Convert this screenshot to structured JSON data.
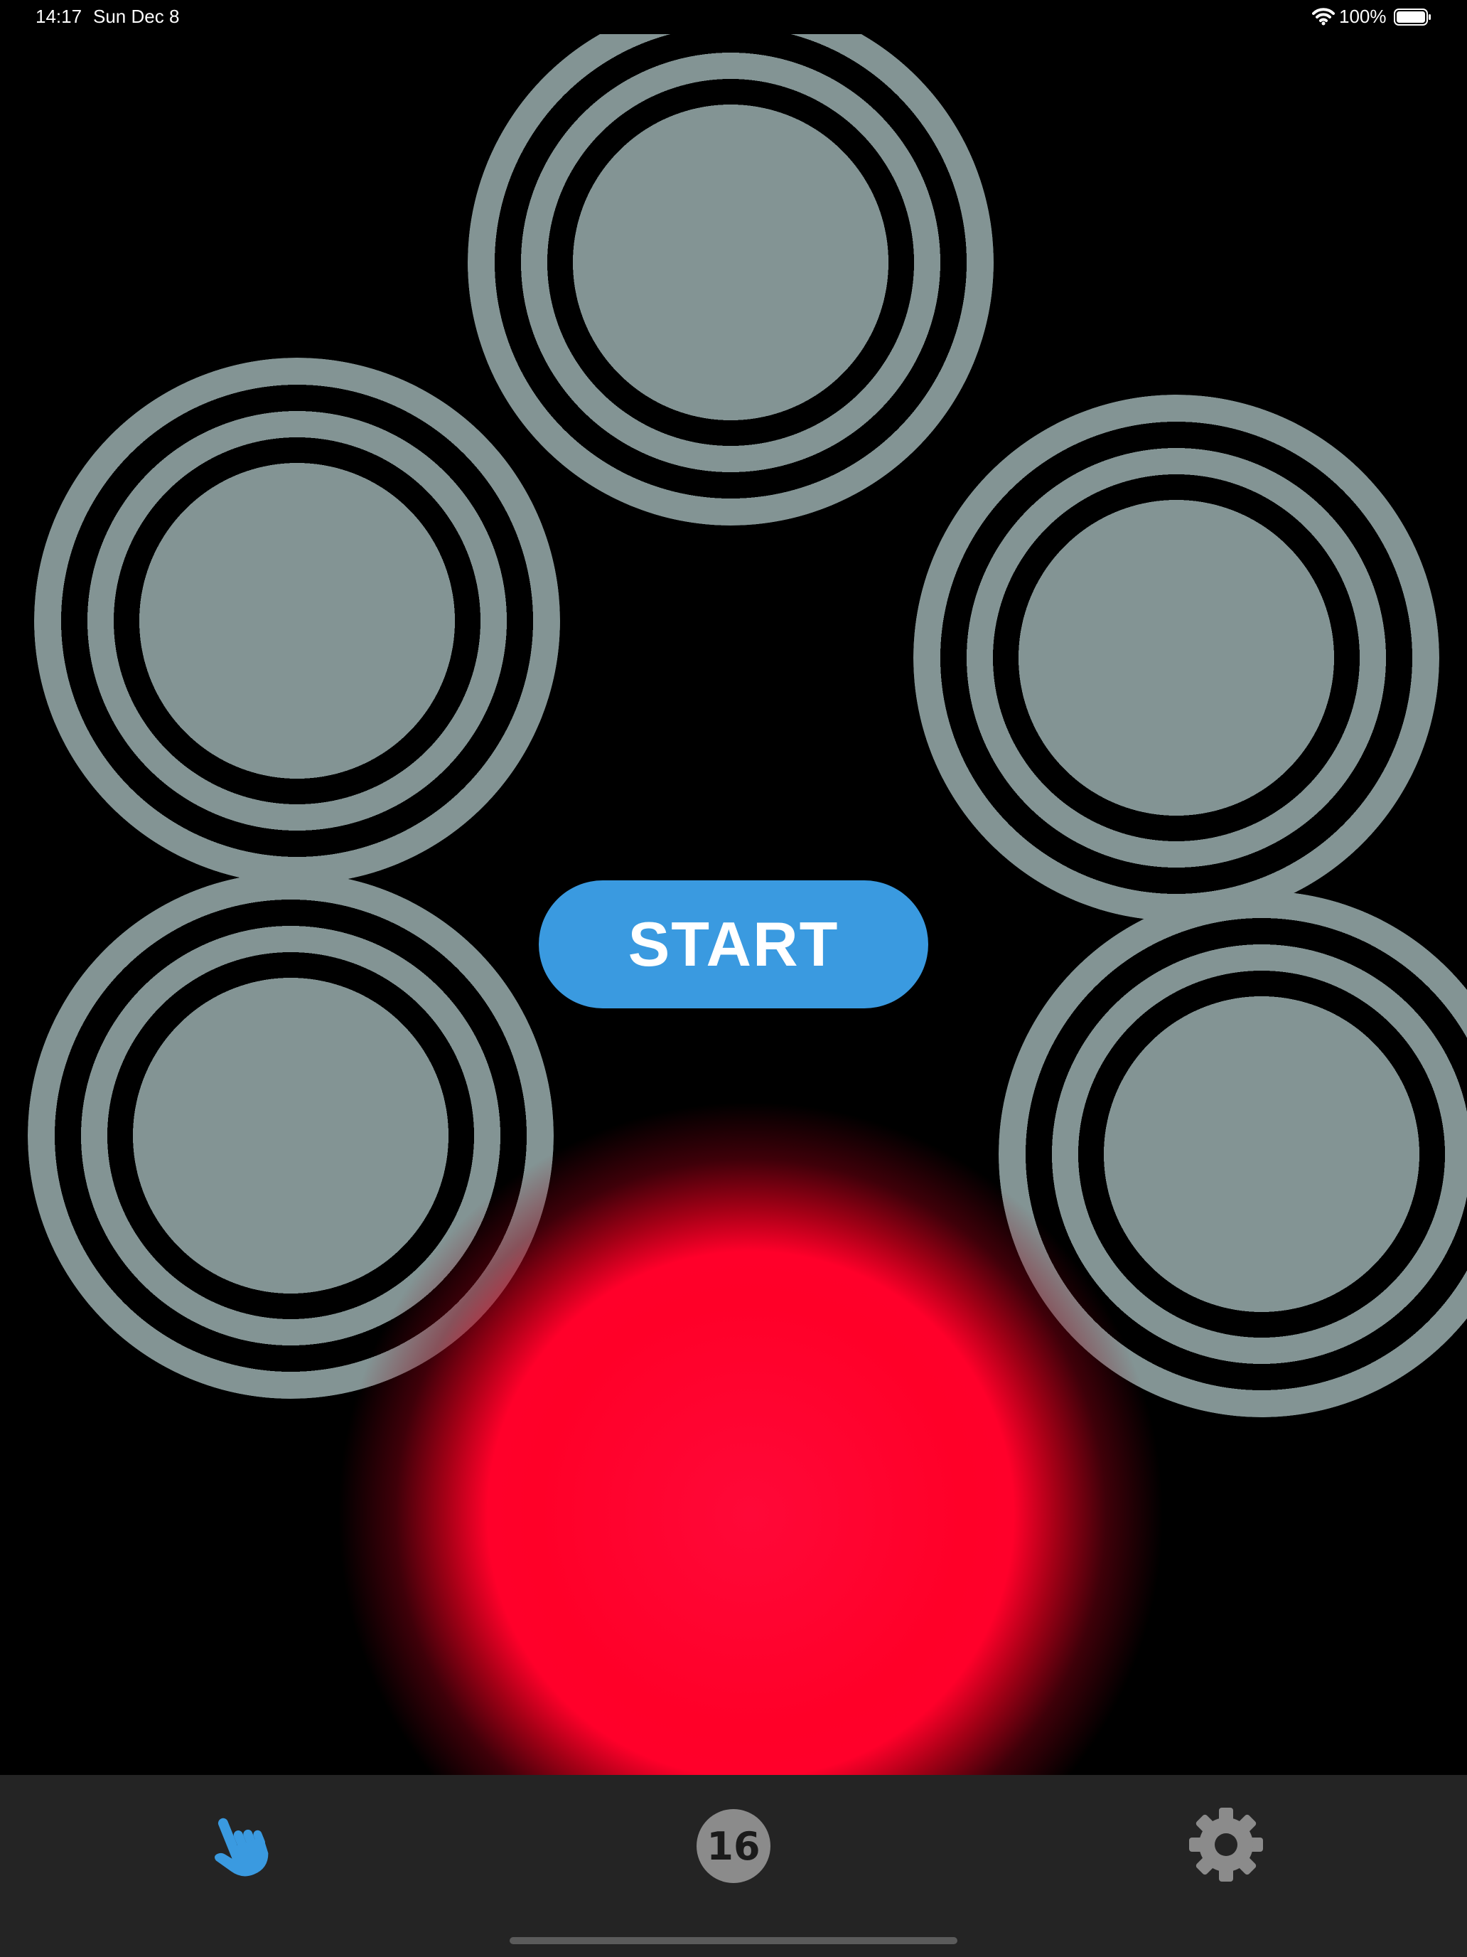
{
  "status_bar": {
    "time": "14:17",
    "date": "Sun Dec 8",
    "battery_percent": "100%"
  },
  "game": {
    "pads": [
      {
        "id": "top",
        "color": "#839494"
      },
      {
        "id": "upper-left",
        "color": "#839494"
      },
      {
        "id": "upper-right",
        "color": "#839494"
      },
      {
        "id": "lower-left",
        "color": "#839494"
      },
      {
        "id": "lower-right",
        "color": "#839494"
      }
    ],
    "active_glow_color": "#ff0028",
    "start_label": "START",
    "start_color": "#3a9ae0"
  },
  "tab_bar": {
    "tabs": [
      {
        "icon": "pointing-hand-icon",
        "active": true,
        "color": "#3a9ae0"
      },
      {
        "icon": "level-badge",
        "label": "16",
        "active": false
      },
      {
        "icon": "gear-icon",
        "active": false,
        "color": "#8b8b8b"
      }
    ]
  }
}
